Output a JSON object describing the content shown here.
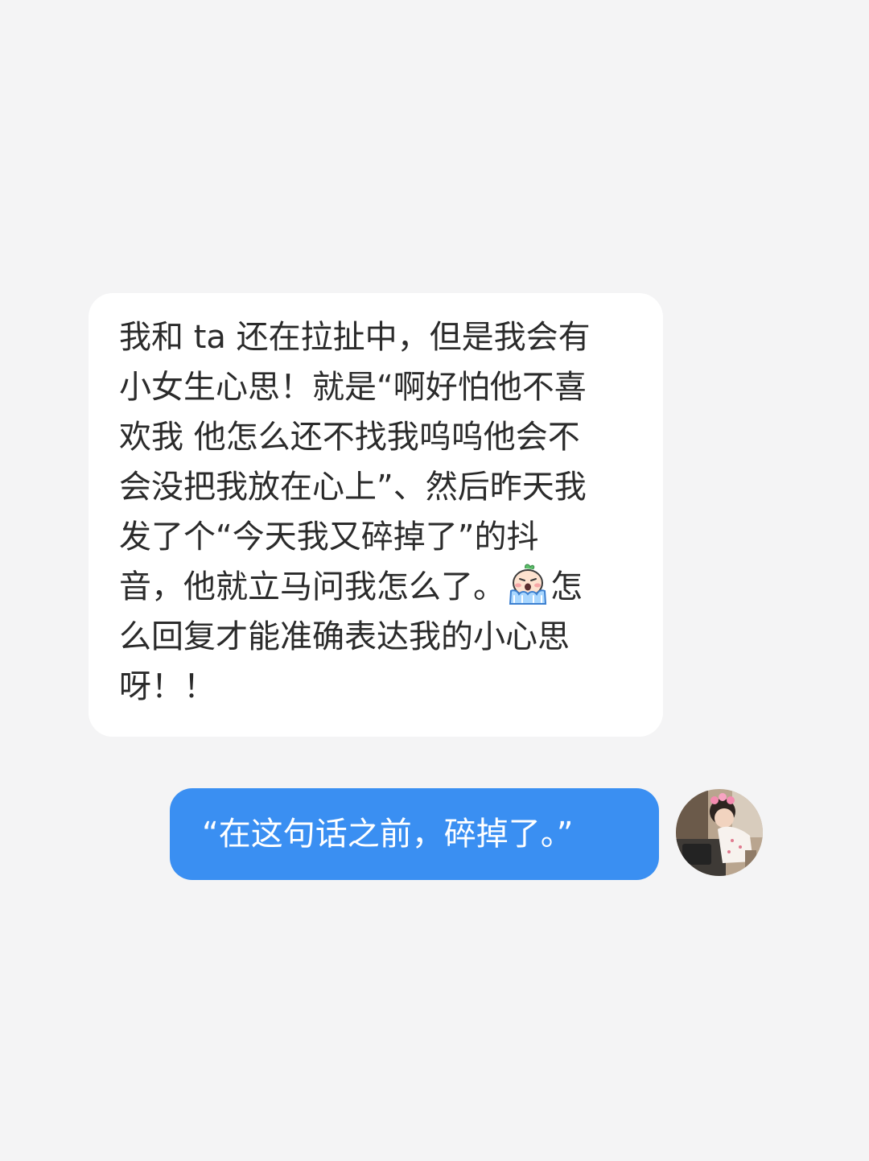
{
  "conversation": {
    "incoming": {
      "lines": [
        "我和 ta 还在拉扯中，但是我会有",
        "小女生心思！就是“啊好怕他不喜",
        "欢我 他怎么还不找我呜呜他会不",
        "会没把我放在心上”、然后昨天我",
        "发了个“今天我又碎掉了”的抖",
        "音，他就立马问我怎么了。",
        "怎",
        "么回复才能准确表达我的小心思",
        "呀！！"
      ],
      "emoji": "crying-face-emoji"
    },
    "outgoing": {
      "text": "“在这句话之前，碎掉了。”"
    },
    "avatar": "avatar-photo"
  },
  "colors": {
    "background": "#f4f4f5",
    "incoming_bubble": "#ffffff",
    "outgoing_bubble": "#3a8ff2",
    "incoming_text": "#2b2b2b",
    "outgoing_text": "#ffffff"
  }
}
